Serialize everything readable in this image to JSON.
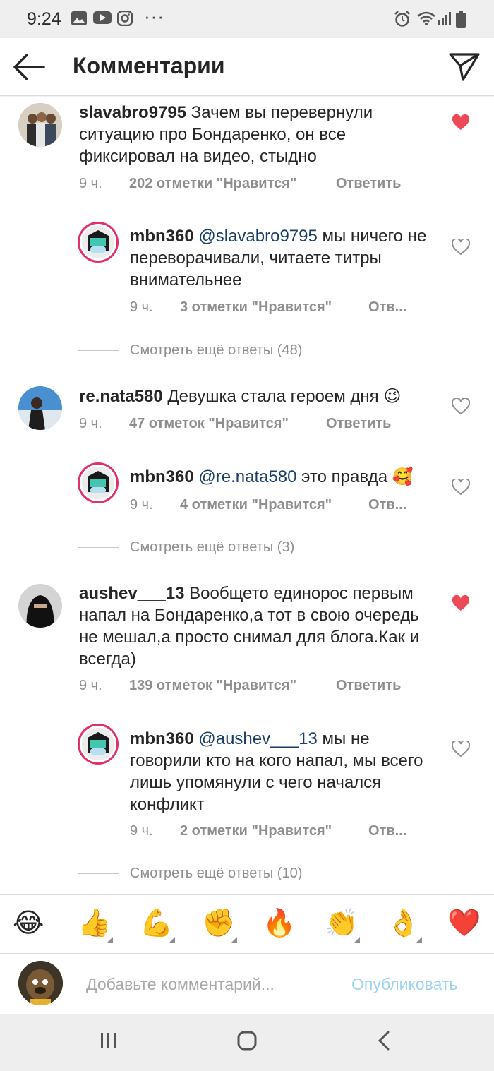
{
  "status": {
    "time": "9:24",
    "dots": "···"
  },
  "header": {
    "title": "Комментарии"
  },
  "comments": [
    {
      "user": "slavabro9795",
      "text": "Зачем вы перевернули ситуацию про Бондаренко, он все фиксировал на видео, стыдно",
      "time": "9 ч.",
      "likes": "202 отметки \"Нравится\"",
      "reply": "Ответить",
      "liked": true,
      "replies": [
        {
          "user": "mbn360",
          "mention": "@slavabro9795",
          "text": "мы ничего не переворачивали, читаете титры внимательнее",
          "time": "9 ч.",
          "likes": "3 отметки \"Нравится\"",
          "reply": "Отв..."
        }
      ],
      "more": "Смотреть ещё ответы (48)"
    },
    {
      "user": "re.nata580",
      "text": "Девушка стала героем дня 😉",
      "time": "9 ч.",
      "likes": "47 отметок \"Нравится\"",
      "reply": "Ответить",
      "liked": false,
      "replies": [
        {
          "user": "mbn360",
          "mention": "@re.nata580",
          "text": "это правда 🥰",
          "time": "9 ч.",
          "likes": "4 отметки \"Нравится\"",
          "reply": "Отв..."
        }
      ],
      "more": "Смотреть ещё ответы (3)"
    },
    {
      "user": "aushev___13",
      "text": "Вообщето единорос первым напал на Бондаренко,а тот в свою очередь не мешал,а просто снимал для блога.Как и всегда)",
      "time": "9 ч.",
      "likes": "139 отметок \"Нравится\"",
      "reply": "Ответить",
      "liked": true,
      "replies": [
        {
          "user": "mbn360",
          "mention": "@aushev___13",
          "text": "мы не говорили кто на кого напал, мы всего лишь упомянули с чего начался конфликт",
          "time": "9 ч.",
          "likes": "2 отметки \"Нравится\"",
          "reply": "Отв..."
        }
      ],
      "more": "Смотреть ещё ответы (10)"
    }
  ],
  "emoji_bar": [
    "😂",
    "👍",
    "💪",
    "✊",
    "🔥",
    "👏",
    "👌",
    "❤️"
  ],
  "composer": {
    "placeholder": "Добавьте комментарий...",
    "post": "Опубликовать"
  },
  "colors": {
    "heart_liked": "#ed4956",
    "link_disabled": "#9fd3f0",
    "mention": "#1b3f67"
  }
}
